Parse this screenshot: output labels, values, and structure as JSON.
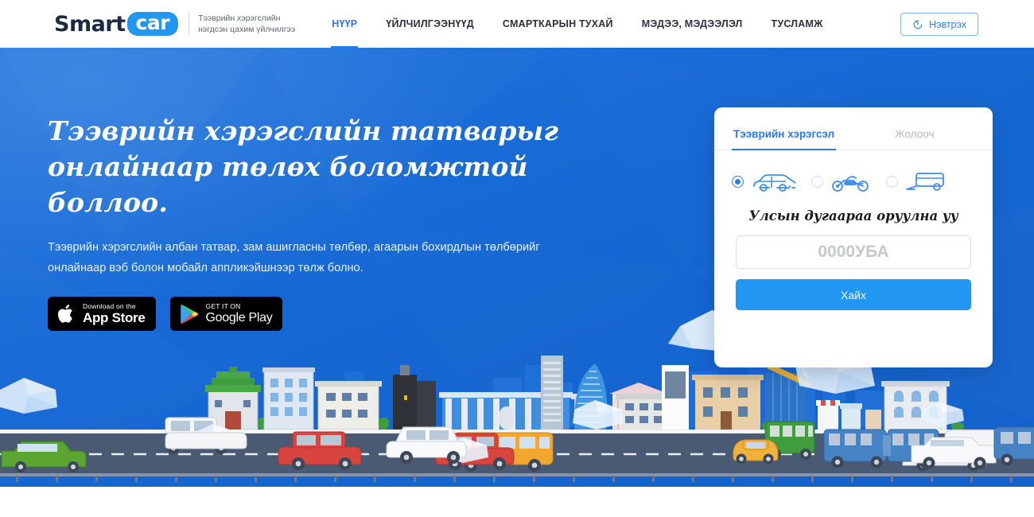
{
  "header": {
    "logo": {
      "part1": "Smart",
      "part2": "car"
    },
    "tagline_line1": "Тээврийн хэрэгслийн",
    "tagline_line2": "нэгдсэн цахим үйлчилгээ",
    "nav": [
      {
        "label": "НҮҮР",
        "active": true
      },
      {
        "label": "ҮЙЛЧИЛГЭЭНҮҮД",
        "active": false
      },
      {
        "label": "СМАРТКАРЫН ТУХАЙ",
        "active": false
      },
      {
        "label": "МЭДЭЭ, МЭДЭЭЛЭЛ",
        "active": false
      },
      {
        "label": "ТУСЛАМЖ",
        "active": false
      }
    ],
    "login_label": "Нэвтрэх",
    "login_icon": "login-circle-arrow-icon"
  },
  "hero": {
    "title": "Тээврийн хэрэгслийн татварыг онлайнаар төлөх боломжтой боллоо.",
    "subtitle": "Тээврийн хэрэгслийн албан татвар, зам ашигласны төлбөр, агаарын бохирдлын төлбөрийг онлайнаар вэб болон мобайл аппликэйшнээр төлж болно.",
    "badges": [
      {
        "icon": "apple-icon",
        "small": "Download on the",
        "big": "App Store"
      },
      {
        "icon": "google-play-icon",
        "small": "GET IT ON",
        "big": "Google Play"
      }
    ]
  },
  "search_card": {
    "tabs": [
      {
        "label": "Тээврийн хэрэгсэл",
        "active": true
      },
      {
        "label": "Жолооч",
        "active": false
      }
    ],
    "vehicle_options": [
      {
        "icon": "car-icon",
        "selected": true
      },
      {
        "icon": "motorcycle-icon",
        "selected": false
      },
      {
        "icon": "trailer-icon",
        "selected": false
      }
    ],
    "plate_label": "Улсын дугаараа оруулна уу",
    "plate_value": "",
    "plate_placeholder": "0000УБА",
    "search_button": "Хайх"
  },
  "colors": {
    "accent_blue": "#2979f0",
    "button_blue": "#2196f3",
    "hero_blue": "#1668d4",
    "logo_navy": "#1d2a44",
    "road_gray": "#4a5a72",
    "muted_gray": "#b4b9c3"
  },
  "illustration": {
    "scene_name": "city-skyline-with-road",
    "vehicles": [
      "green-suv",
      "red-car",
      "yellow-bus",
      "white-car",
      "red-car",
      "green-bus",
      "blue-articulated-bus",
      "yellow-taxi",
      "white-van",
      "blue-bus"
    ],
    "clouds": 6
  }
}
